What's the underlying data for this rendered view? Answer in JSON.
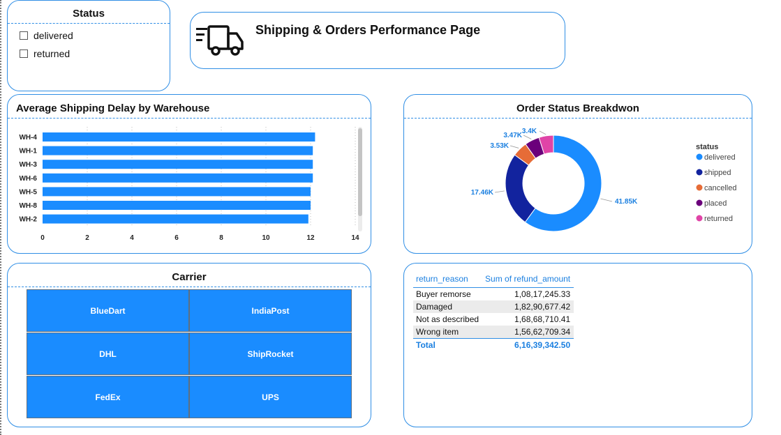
{
  "status_slicer": {
    "title": "Status",
    "options": [
      "delivered",
      "returned"
    ]
  },
  "header": {
    "title": "Shipping & Orders Performance Page",
    "icon": "truck-icon"
  },
  "bar_chart": {
    "title": "Average Shipping Delay by Warehouse"
  },
  "donut_chart": {
    "title": "Order Status Breakdwon",
    "legend_title": "status"
  },
  "carrier": {
    "title": "Carrier",
    "tiles": [
      "BlueDart",
      "IndiaPost",
      "DHL",
      "ShipRocket",
      "FedEx",
      "UPS"
    ]
  },
  "refund_table": {
    "headers": [
      "return_reason",
      "Sum of refund_amount"
    ],
    "rows": [
      [
        "Buyer remorse",
        "1,08,17,245.33"
      ],
      [
        "Damaged",
        "1,82,90,677.42"
      ],
      [
        "Not as described",
        "1,68,68,710.41"
      ],
      [
        "Wrong item",
        "1,56,62,709.34"
      ]
    ],
    "total": [
      "Total",
      "6,16,39,342.50"
    ]
  },
  "colors": {
    "accent": "#2f8ee5",
    "bar": "#1a8cff",
    "delivered": "#1a8cff",
    "shipped": "#12239e",
    "cancelled": "#e66c37",
    "placed": "#6b007b",
    "returned": "#e044a7"
  },
  "chart_data": [
    {
      "type": "bar",
      "orientation": "horizontal",
      "title": "Average Shipping Delay by Warehouse",
      "categories": [
        "WH-4",
        "WH-1",
        "WH-3",
        "WH-6",
        "WH-5",
        "WH-8",
        "WH-2"
      ],
      "values": [
        12.2,
        12.1,
        12.1,
        12.1,
        12.0,
        12.0,
        11.9
      ],
      "xlim": [
        0,
        14
      ],
      "xticks": [
        "0",
        "2",
        "4",
        "6",
        "8",
        "10",
        "12",
        "14"
      ],
      "grid": true
    },
    {
      "type": "pie",
      "donut": true,
      "title": "Order Status Breakdwon",
      "legend_title": "status",
      "legend_position": "right",
      "categories": [
        "delivered",
        "shipped",
        "cancelled",
        "placed",
        "returned"
      ],
      "values": [
        41850,
        17460,
        3530,
        3470,
        3400
      ],
      "labels": [
        "41.85K",
        "17.46K",
        "3.53K",
        "3.47K",
        "3.4K"
      ]
    }
  ]
}
